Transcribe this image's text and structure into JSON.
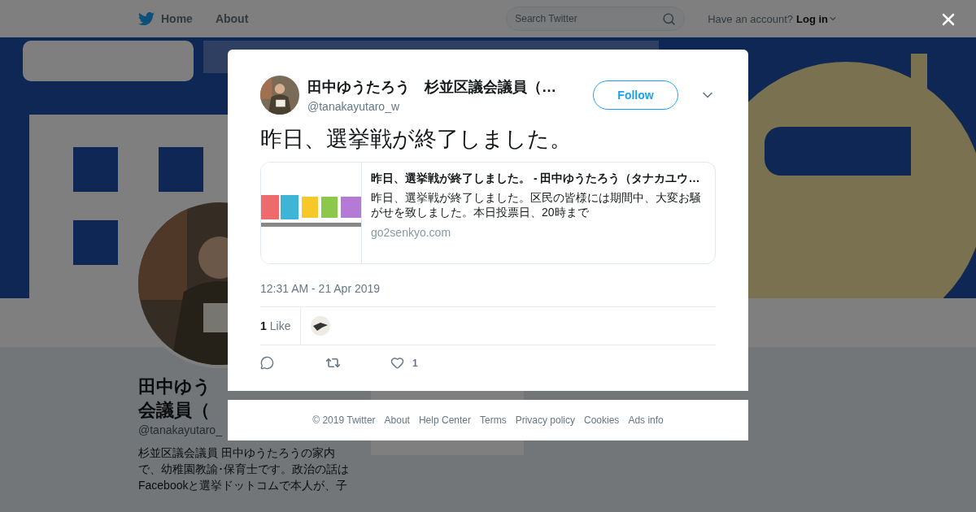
{
  "nav": {
    "links": [
      "Home",
      "About"
    ],
    "search": {
      "placeholder": "Search Twitter"
    },
    "account_prompt": "Have an account?",
    "login": "Log in"
  },
  "profile": {
    "name_lines": [
      "田中ゆう",
      "会議員（"
    ],
    "handle": "@tanakayutaro_",
    "bio_lines": [
      "杉並区議会議員 田中ゆうたろうの家内",
      "で、幼稚園教諭･保育士です。政治の話は",
      "Facebookと選挙ドットコムで本人が、子"
    ]
  },
  "modal": {
    "author": {
      "name": "田中ゆうたろう　杉並区議会議員（…",
      "handle": "@tanakayutaro_w"
    },
    "follow": "Follow",
    "text": "昨日、選挙戦が終了しました。",
    "card": {
      "kind": "picture",
      "title": "昨日、選挙戦が終了しました。 - 田中ゆうたろう（タナカユウ…",
      "description": "昨日、選挙戦が終了しました。区民の皆様には期間中、大変お騒がせを致しました。本日投票日、20時まで",
      "domain": "go2senkyo.com"
    },
    "timestamp": "12:31 AM - 21 Apr 2019",
    "likes": {
      "count": "1",
      "label": "Like"
    },
    "actions": [
      {
        "kind": "reply"
      },
      {
        "kind": "retweet"
      },
      {
        "kind": "like",
        "count": "1"
      }
    ]
  },
  "footer": [
    "© 2019 Twitter",
    "About",
    "Help Center",
    "Terms",
    "Privacy policy",
    "Cookies",
    "Ads info"
  ]
}
